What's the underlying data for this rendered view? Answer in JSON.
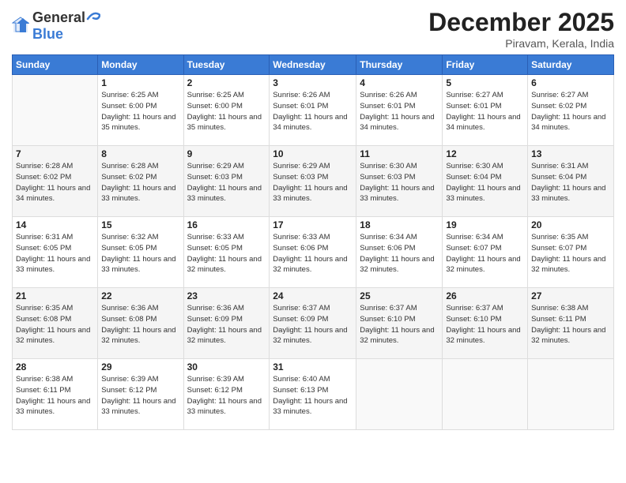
{
  "logo": {
    "general": "General",
    "blue": "Blue"
  },
  "header": {
    "title": "December 2025",
    "subtitle": "Piravam, Kerala, India"
  },
  "calendar": {
    "days_of_week": [
      "Sunday",
      "Monday",
      "Tuesday",
      "Wednesday",
      "Thursday",
      "Friday",
      "Saturday"
    ],
    "weeks": [
      [
        {
          "day": "",
          "info": ""
        },
        {
          "day": "1",
          "info": "Sunrise: 6:25 AM\nSunset: 6:00 PM\nDaylight: 11 hours\nand 35 minutes."
        },
        {
          "day": "2",
          "info": "Sunrise: 6:25 AM\nSunset: 6:00 PM\nDaylight: 11 hours\nand 35 minutes."
        },
        {
          "day": "3",
          "info": "Sunrise: 6:26 AM\nSunset: 6:01 PM\nDaylight: 11 hours\nand 34 minutes."
        },
        {
          "day": "4",
          "info": "Sunrise: 6:26 AM\nSunset: 6:01 PM\nDaylight: 11 hours\nand 34 minutes."
        },
        {
          "day": "5",
          "info": "Sunrise: 6:27 AM\nSunset: 6:01 PM\nDaylight: 11 hours\nand 34 minutes."
        },
        {
          "day": "6",
          "info": "Sunrise: 6:27 AM\nSunset: 6:02 PM\nDaylight: 11 hours\nand 34 minutes."
        }
      ],
      [
        {
          "day": "7",
          "info": "Sunrise: 6:28 AM\nSunset: 6:02 PM\nDaylight: 11 hours\nand 34 minutes."
        },
        {
          "day": "8",
          "info": "Sunrise: 6:28 AM\nSunset: 6:02 PM\nDaylight: 11 hours\nand 33 minutes."
        },
        {
          "day": "9",
          "info": "Sunrise: 6:29 AM\nSunset: 6:03 PM\nDaylight: 11 hours\nand 33 minutes."
        },
        {
          "day": "10",
          "info": "Sunrise: 6:29 AM\nSunset: 6:03 PM\nDaylight: 11 hours\nand 33 minutes."
        },
        {
          "day": "11",
          "info": "Sunrise: 6:30 AM\nSunset: 6:03 PM\nDaylight: 11 hours\nand 33 minutes."
        },
        {
          "day": "12",
          "info": "Sunrise: 6:30 AM\nSunset: 6:04 PM\nDaylight: 11 hours\nand 33 minutes."
        },
        {
          "day": "13",
          "info": "Sunrise: 6:31 AM\nSunset: 6:04 PM\nDaylight: 11 hours\nand 33 minutes."
        }
      ],
      [
        {
          "day": "14",
          "info": "Sunrise: 6:31 AM\nSunset: 6:05 PM\nDaylight: 11 hours\nand 33 minutes."
        },
        {
          "day": "15",
          "info": "Sunrise: 6:32 AM\nSunset: 6:05 PM\nDaylight: 11 hours\nand 33 minutes."
        },
        {
          "day": "16",
          "info": "Sunrise: 6:33 AM\nSunset: 6:05 PM\nDaylight: 11 hours\nand 32 minutes."
        },
        {
          "day": "17",
          "info": "Sunrise: 6:33 AM\nSunset: 6:06 PM\nDaylight: 11 hours\nand 32 minutes."
        },
        {
          "day": "18",
          "info": "Sunrise: 6:34 AM\nSunset: 6:06 PM\nDaylight: 11 hours\nand 32 minutes."
        },
        {
          "day": "19",
          "info": "Sunrise: 6:34 AM\nSunset: 6:07 PM\nDaylight: 11 hours\nand 32 minutes."
        },
        {
          "day": "20",
          "info": "Sunrise: 6:35 AM\nSunset: 6:07 PM\nDaylight: 11 hours\nand 32 minutes."
        }
      ],
      [
        {
          "day": "21",
          "info": "Sunrise: 6:35 AM\nSunset: 6:08 PM\nDaylight: 11 hours\nand 32 minutes."
        },
        {
          "day": "22",
          "info": "Sunrise: 6:36 AM\nSunset: 6:08 PM\nDaylight: 11 hours\nand 32 minutes."
        },
        {
          "day": "23",
          "info": "Sunrise: 6:36 AM\nSunset: 6:09 PM\nDaylight: 11 hours\nand 32 minutes."
        },
        {
          "day": "24",
          "info": "Sunrise: 6:37 AM\nSunset: 6:09 PM\nDaylight: 11 hours\nand 32 minutes."
        },
        {
          "day": "25",
          "info": "Sunrise: 6:37 AM\nSunset: 6:10 PM\nDaylight: 11 hours\nand 32 minutes."
        },
        {
          "day": "26",
          "info": "Sunrise: 6:37 AM\nSunset: 6:10 PM\nDaylight: 11 hours\nand 32 minutes."
        },
        {
          "day": "27",
          "info": "Sunrise: 6:38 AM\nSunset: 6:11 PM\nDaylight: 11 hours\nand 32 minutes."
        }
      ],
      [
        {
          "day": "28",
          "info": "Sunrise: 6:38 AM\nSunset: 6:11 PM\nDaylight: 11 hours\nand 33 minutes."
        },
        {
          "day": "29",
          "info": "Sunrise: 6:39 AM\nSunset: 6:12 PM\nDaylight: 11 hours\nand 33 minutes."
        },
        {
          "day": "30",
          "info": "Sunrise: 6:39 AM\nSunset: 6:12 PM\nDaylight: 11 hours\nand 33 minutes."
        },
        {
          "day": "31",
          "info": "Sunrise: 6:40 AM\nSunset: 6:13 PM\nDaylight: 11 hours\nand 33 minutes."
        },
        {
          "day": "",
          "info": ""
        },
        {
          "day": "",
          "info": ""
        },
        {
          "day": "",
          "info": ""
        }
      ]
    ]
  }
}
